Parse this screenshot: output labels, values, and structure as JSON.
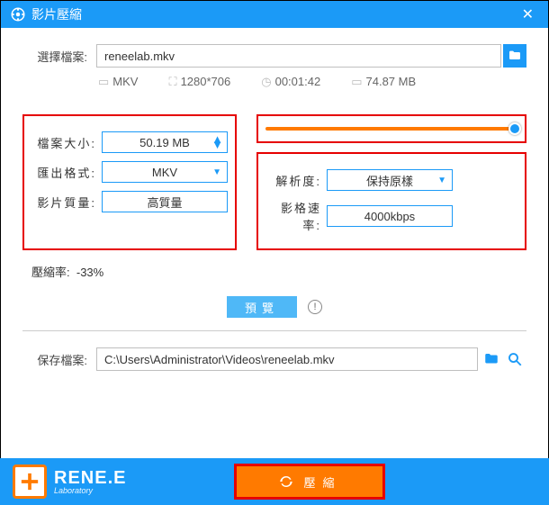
{
  "title": "影片壓縮",
  "file_select": {
    "label": "選擇檔案:",
    "value": "reneelab.mkv"
  },
  "meta": {
    "format": "MKV",
    "resolution": "1280*706",
    "duration": "00:01:42",
    "size": "74.87 MB"
  },
  "settings_left": {
    "filesize": {
      "label": "檔案大小:",
      "value": "50.19 MB"
    },
    "outformat": {
      "label": "匯出格式:",
      "value": "MKV"
    },
    "quality": {
      "label": "影片質量:",
      "value": "高質量"
    }
  },
  "settings_right": {
    "resolution": {
      "label": "解析度:",
      "value": "保持原樣"
    },
    "bitrate": {
      "label": "影格速率:",
      "value": "4000kbps"
    }
  },
  "compress_ratio": {
    "label": "壓縮率:",
    "value": "-33%"
  },
  "preview_label": "預覽",
  "save": {
    "label": "保存檔案:",
    "value": "C:\\Users\\Administrator\\Videos\\reneelab.mkv"
  },
  "brand": {
    "name": "RENE.E",
    "sub": "Laboratory"
  },
  "compress_btn": "壓縮"
}
